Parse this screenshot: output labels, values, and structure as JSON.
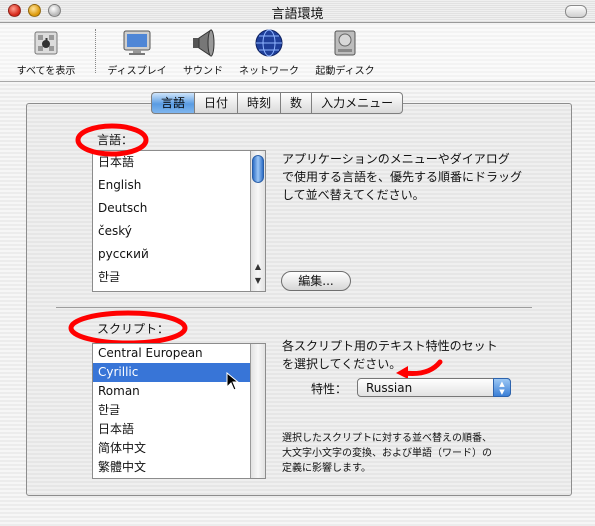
{
  "window": {
    "title": "言語環境"
  },
  "toolbar": {
    "items": [
      {
        "label": "すべてを表示",
        "icon": "apple-grid-icon"
      },
      {
        "label": "ディスプレイ",
        "icon": "display-icon"
      },
      {
        "label": "サウンド",
        "icon": "speaker-icon"
      },
      {
        "label": "ネットワーク",
        "icon": "globe-icon"
      },
      {
        "label": "起動ディスク",
        "icon": "disk-icon"
      }
    ]
  },
  "tabs": [
    {
      "label": "言語"
    },
    {
      "label": "日付"
    },
    {
      "label": "時刻"
    },
    {
      "label": "数"
    },
    {
      "label": "入力メニュー"
    }
  ],
  "language_section": {
    "label": "言語：",
    "items": [
      "日本語",
      "English",
      "Deutsch",
      "český",
      "русский",
      "한글"
    ],
    "description": [
      "アプリケーションのメニューやダイアログ",
      "で使用する言語を、優先する順番にドラッグ",
      "して並べ替えてください。"
    ],
    "edit_button": "編集..."
  },
  "script_section": {
    "label": "スクリプト：",
    "items": [
      "Central European",
      "Cyrillic",
      "Roman",
      "한글",
      "日本語",
      "简体中文",
      "繁體中文"
    ],
    "selected_index": 1,
    "description": [
      "各スクリプト用のテキスト特性のセット",
      "を選択してください。"
    ],
    "trait_label": "特性：",
    "trait_value": "Russian",
    "note": [
      "選択したスクリプトに対する並べ替えの順番、",
      "大文字小文字の変換、および単語（ワード）の",
      "定義に影響します。"
    ]
  },
  "colors": {
    "selection": "#3875d7",
    "annotation": "#ff0000",
    "tab_active": "#5a9ce2"
  }
}
